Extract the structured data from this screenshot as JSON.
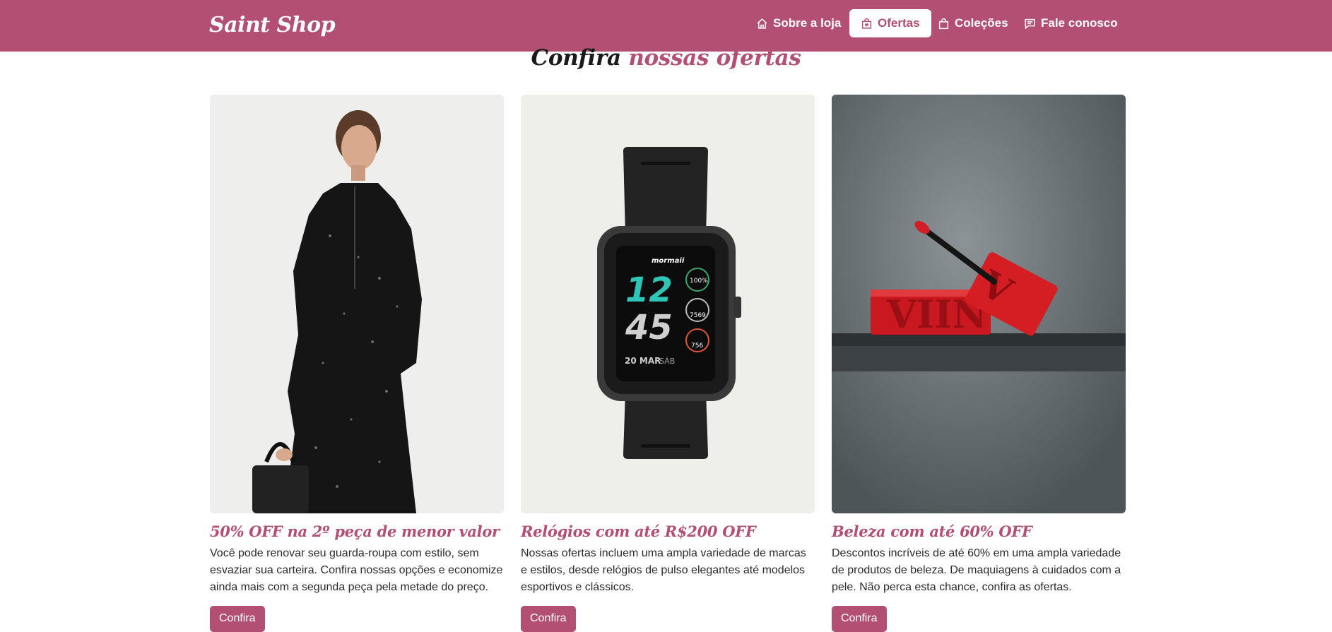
{
  "brand": "Saint Shop",
  "nav": [
    {
      "label": "Sobre a loja",
      "icon": "home-icon"
    },
    {
      "label": "Ofertas",
      "icon": "shopping-bag-icon",
      "active": true
    },
    {
      "label": "Coleções",
      "icon": "bag-icon"
    },
    {
      "label": "Fale conosco",
      "icon": "chat-icon"
    }
  ],
  "section": {
    "title_plain": "Confira",
    "title_accent": "nossas ofertas"
  },
  "cards": [
    {
      "title": "50% OFF na 2º peça de menor valor",
      "text": "Você pode renovar seu guarda-roupa com estilo, sem esvaziar sua carteira. Confira nossas opções e economize ainda mais com a segunda peça pela metade do preço.",
      "button": "Confira"
    },
    {
      "title": "Relógios com até R$200 OFF",
      "text": "Nossas ofertas incluem uma ampla variedade de marcas e estilos, desde relógios de pulso elegantes até modelos esportivos e clássicos.",
      "button": "Confira"
    },
    {
      "title": "Beleza com até 60% OFF",
      "text": "Descontos incríveis de até 60% em uma ampla variedade de produtos de beleza. De maquiagens à cuidados com a pele. Não perca esta chance, confira as ofertas.",
      "button": "Confira"
    }
  ],
  "watch_face": {
    "brand": "mormaii",
    "hour": "12",
    "minute": "45",
    "date": "20 MAR",
    "day": "SÁB",
    "battery": "100%",
    "steps": "7569",
    "calories": "756"
  },
  "colors": {
    "brand": "#b24f73",
    "white": "#ffffff"
  }
}
